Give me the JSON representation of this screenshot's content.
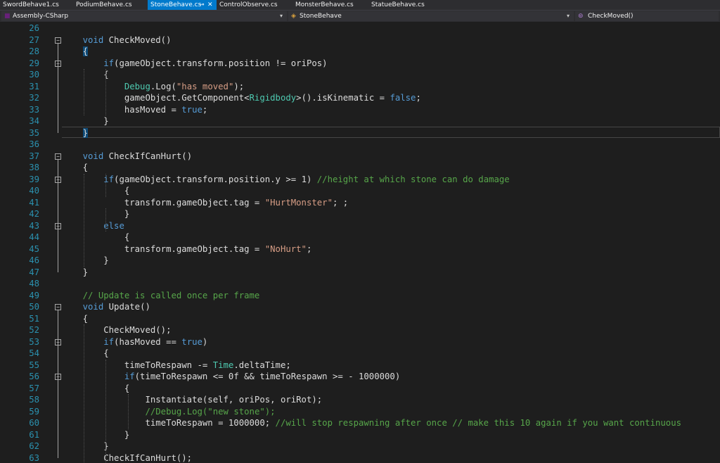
{
  "tabs": [
    {
      "label": "SwordBehave1.cs",
      "active": false
    },
    {
      "label": "PodiumBehave.cs",
      "active": false
    },
    {
      "label": "StoneBehave.cs",
      "active": true
    },
    {
      "label": "ControlObserve.cs",
      "active": false
    },
    {
      "label": "MonsterBehave.cs",
      "active": false
    },
    {
      "label": "StatueBehave.cs",
      "active": false
    }
  ],
  "tab_pin_glyph": "⊸",
  "tab_close_glyph": "✕",
  "navbar": {
    "project": "Assembly-CSharp",
    "class": "StoneBehave",
    "member": "CheckMoved()"
  },
  "colors": {
    "keyword": "#569cd6",
    "type": "#4ec9b0",
    "string": "#d69d85",
    "comment": "#57a64a",
    "line_number": "#2b91af",
    "active_tab": "#007acc"
  },
  "lines": [
    {
      "n": "26",
      "t": []
    },
    {
      "n": "27",
      "t": [
        [
          "    ",
          ""
        ],
        [
          "void",
          "kw"
        ],
        [
          " CheckMoved()",
          ""
        ]
      ]
    },
    {
      "n": "28",
      "t": [
        [
          "    ",
          ""
        ],
        [
          "{",
          "brace"
        ]
      ]
    },
    {
      "n": "29",
      "t": [
        [
          "        ",
          ""
        ],
        [
          "if",
          "kw"
        ],
        [
          "(gameObject.transform.position != oriPos)",
          ""
        ]
      ]
    },
    {
      "n": "30",
      "t": [
        [
          "        {",
          ""
        ]
      ]
    },
    {
      "n": "31",
      "t": [
        [
          "            ",
          ""
        ],
        [
          "Debug",
          "ty"
        ],
        [
          ".Log(",
          ""
        ],
        [
          "\"has moved\"",
          "st"
        ],
        [
          ");",
          ""
        ]
      ]
    },
    {
      "n": "32",
      "t": [
        [
          "            gameObject.GetComponent<",
          ""
        ],
        [
          "Rigidbody",
          "ty"
        ],
        [
          ">().isKinematic = ",
          ""
        ],
        [
          "false",
          "kw"
        ],
        [
          ";",
          ""
        ]
      ]
    },
    {
      "n": "33",
      "t": [
        [
          "            hasMoved = ",
          ""
        ],
        [
          "true",
          "kw"
        ],
        [
          ";",
          ""
        ]
      ]
    },
    {
      "n": "34",
      "t": [
        [
          "        }",
          ""
        ]
      ]
    },
    {
      "n": "35",
      "t": [
        [
          "    ",
          ""
        ],
        [
          "}",
          "brace"
        ]
      ]
    },
    {
      "n": "36",
      "t": []
    },
    {
      "n": "37",
      "t": [
        [
          "    ",
          ""
        ],
        [
          "void",
          "kw"
        ],
        [
          " CheckIfCanHurt()",
          ""
        ]
      ]
    },
    {
      "n": "38",
      "t": [
        [
          "    {",
          ""
        ]
      ]
    },
    {
      "n": "39",
      "t": [
        [
          "        ",
          ""
        ],
        [
          "if",
          "kw"
        ],
        [
          "(gameObject.transform.position.y >= 1) ",
          ""
        ],
        [
          "//height at which stone can do damage",
          "cm"
        ]
      ]
    },
    {
      "n": "40",
      "t": [
        [
          "            {",
          ""
        ]
      ]
    },
    {
      "n": "41",
      "t": [
        [
          "            transform.gameObject.tag = ",
          ""
        ],
        [
          "\"HurtMonster\"",
          "st"
        ],
        [
          "; ;",
          ""
        ]
      ]
    },
    {
      "n": "42",
      "t": [
        [
          "            }",
          ""
        ]
      ]
    },
    {
      "n": "43",
      "t": [
        [
          "        ",
          ""
        ],
        [
          "else",
          "kw"
        ]
      ]
    },
    {
      "n": "44",
      "t": [
        [
          "            {",
          ""
        ]
      ]
    },
    {
      "n": "45",
      "t": [
        [
          "            transform.gameObject.tag = ",
          ""
        ],
        [
          "\"NoHurt\"",
          "st"
        ],
        [
          ";",
          ""
        ]
      ]
    },
    {
      "n": "46",
      "t": [
        [
          "        }",
          ""
        ]
      ]
    },
    {
      "n": "47",
      "t": [
        [
          "    }",
          ""
        ]
      ]
    },
    {
      "n": "48",
      "t": []
    },
    {
      "n": "49",
      "t": [
        [
          "    ",
          ""
        ],
        [
          "// Update is called once per frame",
          "cm"
        ]
      ]
    },
    {
      "n": "50",
      "t": [
        [
          "    ",
          ""
        ],
        [
          "void",
          "kw"
        ],
        [
          " Update()",
          ""
        ]
      ]
    },
    {
      "n": "51",
      "t": [
        [
          "    {",
          ""
        ]
      ]
    },
    {
      "n": "52",
      "t": [
        [
          "        CheckMoved();",
          ""
        ]
      ]
    },
    {
      "n": "53",
      "t": [
        [
          "        ",
          ""
        ],
        [
          "if",
          "kw"
        ],
        [
          "(hasMoved == ",
          ""
        ],
        [
          "true",
          "kw"
        ],
        [
          ")",
          ""
        ]
      ]
    },
    {
      "n": "54",
      "t": [
        [
          "        {",
          ""
        ]
      ]
    },
    {
      "n": "55",
      "t": [
        [
          "            timeToRespawn -= ",
          ""
        ],
        [
          "Time",
          "ty"
        ],
        [
          ".deltaTime;",
          ""
        ]
      ]
    },
    {
      "n": "56",
      "t": [
        [
          "            ",
          ""
        ],
        [
          "if",
          "kw"
        ],
        [
          "(timeToRespawn <= 0f && timeToRespawn >= - 1000000)",
          ""
        ]
      ]
    },
    {
      "n": "57",
      "t": [
        [
          "            {",
          ""
        ]
      ]
    },
    {
      "n": "58",
      "t": [
        [
          "                Instantiate(self, oriPos, oriRot);",
          ""
        ]
      ]
    },
    {
      "n": "59",
      "t": [
        [
          "                ",
          ""
        ],
        [
          "//Debug.Log(\"new stone\");",
          "cm"
        ]
      ]
    },
    {
      "n": "60",
      "t": [
        [
          "                timeToRespawn = 1000000; ",
          ""
        ],
        [
          "//will stop respawning after once // make this 10 again if you want continuous",
          "cm"
        ]
      ]
    },
    {
      "n": "61",
      "t": [
        [
          "            }",
          ""
        ]
      ]
    },
    {
      "n": "62",
      "t": [
        [
          "        }",
          ""
        ]
      ]
    },
    {
      "n": "63",
      "t": [
        [
          "        CheckIfCanHurt();",
          ""
        ]
      ]
    }
  ]
}
